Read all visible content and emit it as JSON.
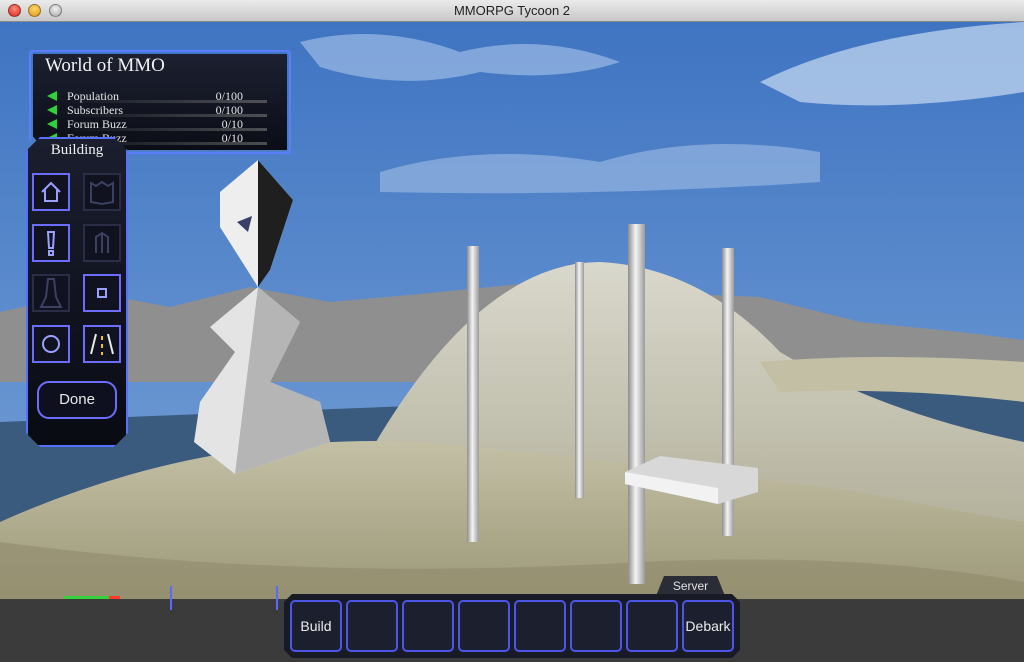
{
  "window": {
    "title": "MMORPG Tycoon 2"
  },
  "stats_panel": {
    "world_name": "World of MMO",
    "rows": [
      {
        "label": "Population",
        "value": "0/100"
      },
      {
        "label": "Subscribers",
        "value": "0/100"
      },
      {
        "label": "Forum Buzz",
        "value": "0/10"
      },
      {
        "label": "Forum Buzz",
        "value": "0/10"
      }
    ]
  },
  "building_panel": {
    "title": "Building",
    "tools": [
      {
        "icon": "house-icon",
        "enabled": true
      },
      {
        "icon": "castle-icon",
        "enabled": false
      },
      {
        "icon": "exclamation-icon",
        "enabled": true
      },
      {
        "icon": "door-icon",
        "enabled": false
      },
      {
        "icon": "tower-icon",
        "enabled": false
      },
      {
        "icon": "small-square-icon",
        "enabled": true
      },
      {
        "icon": "circle-icon",
        "enabled": true
      },
      {
        "icon": "road-icon",
        "enabled": true
      }
    ],
    "done_label": "Done"
  },
  "server_tab": {
    "label": "Server"
  },
  "action_bar": {
    "slots": [
      "Build",
      "",
      "",
      "",
      "",
      "",
      "",
      "Debark"
    ]
  },
  "colors": {
    "panel_glow": "#5b7dff",
    "stat_arrow": "#2fd23a",
    "tile_border": "#6c6cff",
    "toolbar_strip": "#3b3b3b"
  }
}
